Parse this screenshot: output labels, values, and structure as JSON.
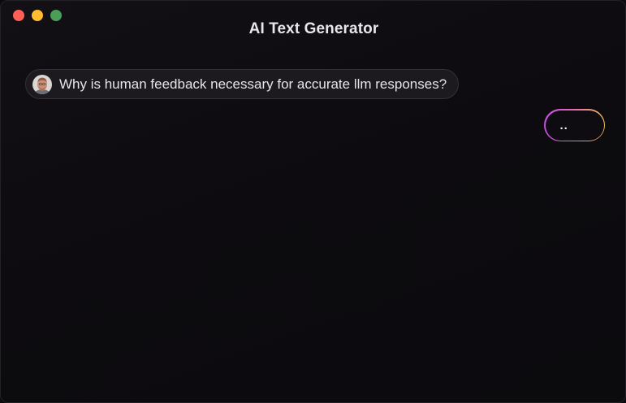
{
  "window": {
    "title": "AI Text Generator",
    "controls": [
      "close-icon",
      "minimize-icon",
      "maximize-icon"
    ]
  },
  "conversation": {
    "user_message": {
      "avatar": "user-avatar",
      "text": "Why is human feedback necessary for accurate llm responses?"
    },
    "assistant_reply": {
      "text": ".."
    }
  },
  "colors": {
    "background": "#0d0b0f",
    "close": "#fe5f57",
    "minimize": "#febc2e",
    "maximize": "#5fcf70",
    "reply_gradient": [
      "#c44fe8",
      "#e86bb4",
      "#f4c04d"
    ]
  }
}
